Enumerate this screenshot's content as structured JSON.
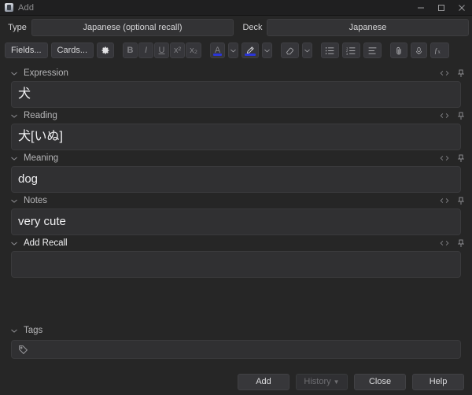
{
  "window": {
    "title": "Add",
    "app_icon": "anki-icon",
    "controls": {
      "minimize": "minimize-icon",
      "maximize": "maximize-icon",
      "close": "close-icon"
    }
  },
  "selectors": {
    "type_label": "Type",
    "type_value": "Japanese (optional recall)",
    "deck_label": "Deck",
    "deck_value": "Japanese"
  },
  "toolbar": {
    "fields_label": "Fields...",
    "cards_label": "Cards...",
    "settings_icon": "gear-icon",
    "bold_label": "B",
    "italic_label": "I",
    "underline_label": "U",
    "superscript_label": "x²",
    "subscript_label": "x₂",
    "text_color_label": "A",
    "text_color_swatch": "#2b36d8",
    "text_color_chevron": "chevron-down-icon",
    "highlight_icon": "highlighter-pen-icon",
    "highlight_swatch": "#2b36d8",
    "highlight_chevron": "chevron-down-icon",
    "eraser_icon": "eraser-icon",
    "eraser_chevron": "chevron-down-icon",
    "bullet_list_icon": "bullet-list-icon",
    "numbered_list_icon": "numbered-list-icon",
    "justify_icon": "text-align-icon",
    "attach_icon": "paperclip-icon",
    "record_icon": "microphone-icon",
    "equation_icon": "fx-equation-icon"
  },
  "field_icons": {
    "html_editor": "html-code-icon",
    "pin": "pin-icon",
    "collapse": "chevron-down-icon"
  },
  "fields": [
    {
      "name": "Expression",
      "value": "犬",
      "active": false
    },
    {
      "name": "Reading",
      "value": "犬[いぬ]",
      "active": false
    },
    {
      "name": "Meaning",
      "value": "dog",
      "active": false
    },
    {
      "name": "Notes",
      "value": "very cute",
      "active": false
    },
    {
      "name": "Add Recall",
      "value": "",
      "active": true
    }
  ],
  "tags": {
    "label": "Tags",
    "value": "",
    "icon": "tag-icon",
    "collapse": "chevron-down-icon"
  },
  "buttons": {
    "add": "Add",
    "history": "History",
    "history_arrow": "▼",
    "history_disabled": true,
    "close": "Close",
    "help": "Help"
  }
}
